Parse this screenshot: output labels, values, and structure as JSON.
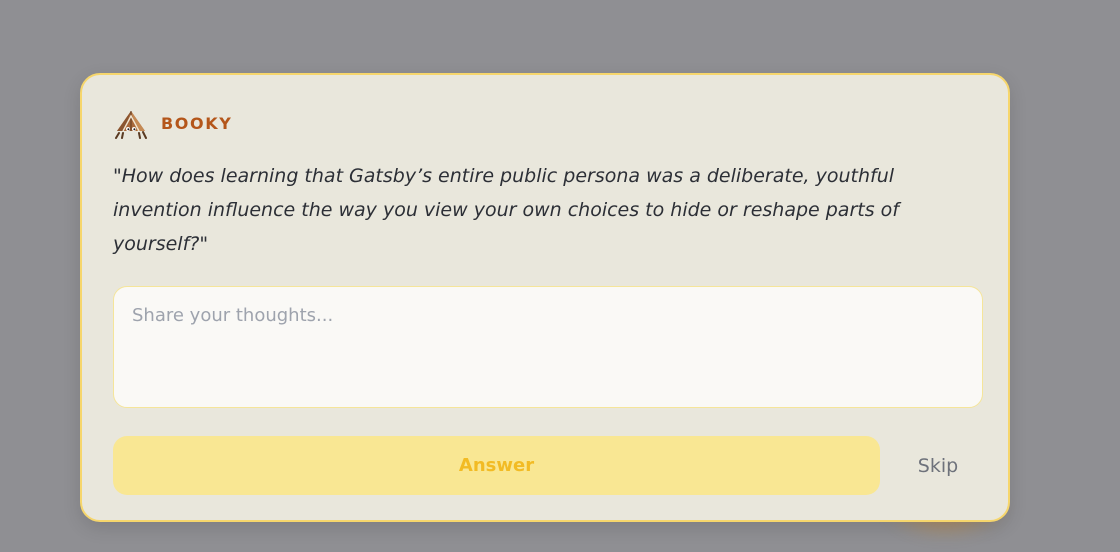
{
  "prompt_card": {
    "assistant_name": "BOOKY",
    "avatar_icon": "booky-crab-icon",
    "question": "\"How does learning that Gatsby’s entire public persona was a deliberate, youthful invention influence the way you view your own choices to hide or reshape parts of yourself?\"",
    "answer_input": {
      "value": "",
      "placeholder": "Share your thoughts..."
    },
    "answer_button_label": "Answer",
    "skip_button_label": "Skip"
  },
  "colors": {
    "backdrop": "#8f8f93",
    "card_background": "#e9e7dc",
    "card_border": "#f6d66c",
    "name_accent": "#b4561a",
    "answer_button_bg": "#f9e793",
    "answer_button_text": "#f2bb24"
  }
}
